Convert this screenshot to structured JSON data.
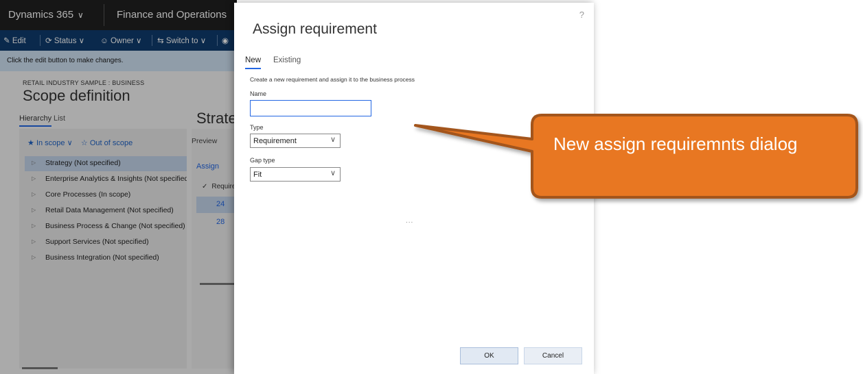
{
  "app": {
    "product": "Dynamics 365",
    "module": "Finance and Operations",
    "actions": {
      "edit": "Edit",
      "status": "Status",
      "owner": "Owner",
      "switch_to": "Switch to"
    },
    "message": "Click the edit button to make changes.",
    "breadcrumb": "RETAIL INDUSTRY SAMPLE : BUSINESS",
    "page_title": "Scope definition",
    "tabs": {
      "hierarchy": "Hierarchy",
      "list": "List"
    },
    "filters": {
      "in_scope": "In scope",
      "out_of_scope": "Out of scope"
    },
    "tree_items": [
      "Strategy (Not specified)",
      "Enterprise Analytics & Insights (Not specified)",
      "Core Processes (In scope)",
      "Retail Data Management (Not specified)",
      "Business Process & Change (Not specified)",
      "Support Services (Not specified)",
      "Business Integration (Not specified)"
    ],
    "detail": {
      "title": "Strategy",
      "preview_label": "Preview",
      "assign_label": "Assign",
      "req_column": "Requirement",
      "req_ids": [
        "24",
        "28"
      ]
    }
  },
  "dialog": {
    "title": "Assign requirement",
    "help": "?",
    "tabs": {
      "new": "New",
      "existing": "Existing"
    },
    "description": "Create a new requirement and assign it to the business process",
    "name": {
      "label": "Name",
      "value": ""
    },
    "type": {
      "label": "Type",
      "value": "Requirement"
    },
    "gap_type": {
      "label": "Gap type",
      "value": "Fit"
    },
    "ellipsis": "...",
    "ok": "OK",
    "cancel": "Cancel"
  },
  "callout": {
    "text": "New assign requiremnts dialog",
    "fill_color": "#E87722",
    "border_color": "#A3541A"
  }
}
